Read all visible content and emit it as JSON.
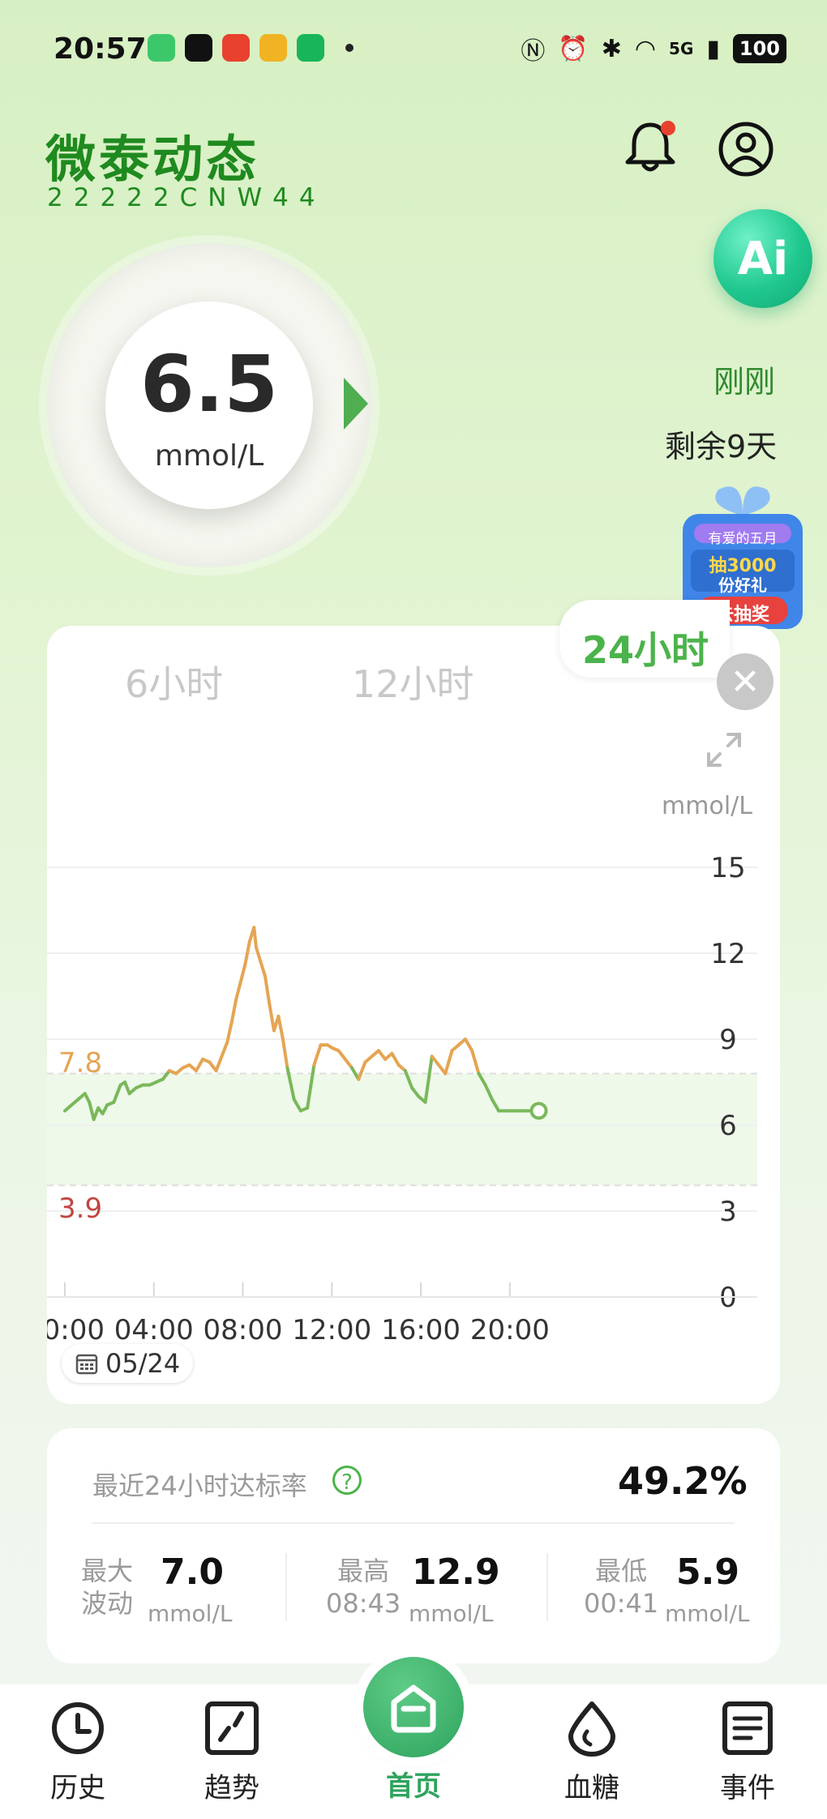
{
  "status_bar": {
    "time": "20:57",
    "battery": "100",
    "network": "5G",
    "app_icon_colors": [
      "#3cc86a",
      "#111111",
      "#e8422f",
      "#f0b323",
      "#18b55a"
    ]
  },
  "header": {
    "title": "微泰动态",
    "serial": "22222CNW44",
    "ai_label": "Ai"
  },
  "reading": {
    "value": "6.5",
    "unit": "mmol/L",
    "time_ago": "刚刚",
    "remaining": "剩余9天"
  },
  "promo": {
    "line1": "有爱的五月",
    "line2": "抽3000",
    "line3": "份好礼",
    "cta": "去抽奖"
  },
  "tabs": [
    {
      "label": "6小时",
      "active": false
    },
    {
      "label": "12小时",
      "active": false
    },
    {
      "label": "24小时",
      "active": true
    }
  ],
  "chart_data": {
    "type": "line",
    "ylabel": "mmol/L",
    "ylim": [
      0,
      15
    ],
    "y_ticks": [
      "15",
      "12",
      "9",
      "6",
      "3",
      "0"
    ],
    "xlim": [
      0,
      21.5
    ],
    "x_ticks": [
      "00:00",
      "04:00",
      "08:00",
      "12:00",
      "16:00",
      "20:00"
    ],
    "target_high": "7.8",
    "target_low": "3.9",
    "target_high_value": 7.8,
    "target_low_value": 3.9,
    "date": "05/24",
    "colors": {
      "in_range": "#7ab85a",
      "high": "#e5a553",
      "high_label": "#e5a553",
      "low_label": "#c0463f"
    },
    "x": [
      0,
      0.3,
      0.6,
      0.9,
      1.1,
      1.3,
      1.5,
      1.7,
      1.9,
      2.2,
      2.5,
      2.7,
      2.9,
      3.2,
      3.5,
      3.8,
      4.1,
      4.4,
      4.7,
      5.0,
      5.3,
      5.6,
      5.9,
      6.2,
      6.5,
      6.8,
      7.1,
      7.3,
      7.5,
      7.7,
      7.9,
      8.1,
      8.3,
      8.5,
      8.6,
      8.8,
      9.0,
      9.2,
      9.4,
      9.6,
      9.8,
      10.0,
      10.3,
      10.6,
      10.9,
      11.2,
      11.5,
      11.8,
      12.0,
      12.3,
      12.6,
      12.9,
      13.2,
      13.5,
      13.8,
      14.1,
      14.4,
      14.7,
      15.0,
      15.3,
      15.6,
      15.9,
      16.2,
      16.5,
      16.8,
      17.1,
      17.4,
      17.7,
      18.0,
      18.3,
      18.6,
      18.9,
      19.2,
      19.5,
      19.8,
      20.1,
      20.4,
      20.7,
      21.0,
      21.3
    ],
    "values": [
      6.5,
      6.7,
      6.9,
      7.1,
      6.8,
      6.2,
      6.6,
      6.4,
      6.7,
      6.8,
      7.4,
      7.5,
      7.1,
      7.3,
      7.4,
      7.4,
      7.5,
      7.6,
      7.9,
      7.8,
      8.0,
      8.1,
      7.9,
      8.3,
      8.2,
      7.9,
      8.5,
      8.9,
      9.6,
      10.4,
      11.0,
      11.6,
      12.4,
      12.9,
      12.2,
      11.7,
      11.2,
      10.2,
      9.3,
      9.8,
      9.0,
      8.0,
      6.9,
      6.5,
      6.6,
      8.1,
      8.8,
      8.8,
      8.7,
      8.6,
      8.3,
      8.0,
      7.6,
      8.2,
      8.4,
      8.6,
      8.3,
      8.5,
      8.1,
      7.9,
      7.3,
      7.0,
      6.8,
      8.4,
      8.1,
      7.8,
      8.6,
      8.8,
      9.0,
      8.6,
      7.8,
      7.4,
      6.9,
      6.5,
      6.5,
      6.5,
      6.5,
      6.5,
      6.5,
      6.5
    ]
  },
  "stats": {
    "rate_label": "最近24小时达标率",
    "rate_help": "?",
    "rate_value": "49.2%",
    "max_fluct_label_1": "最大",
    "max_fluct_label_2": "波动",
    "max_fluct_value": "7.0",
    "highest_label": "最高",
    "highest_time": "08:43",
    "highest_value": "12.9",
    "lowest_label": "最低",
    "lowest_time": "00:41",
    "lowest_value": "5.9",
    "unit": "mmol/L"
  },
  "nav": [
    {
      "label": "历史",
      "icon": "history-icon"
    },
    {
      "label": "趋势",
      "icon": "trend-icon"
    },
    {
      "label": "首页",
      "icon": "home-icon"
    },
    {
      "label": "血糖",
      "icon": "blood-drop-icon"
    },
    {
      "label": "事件",
      "icon": "event-icon"
    }
  ]
}
